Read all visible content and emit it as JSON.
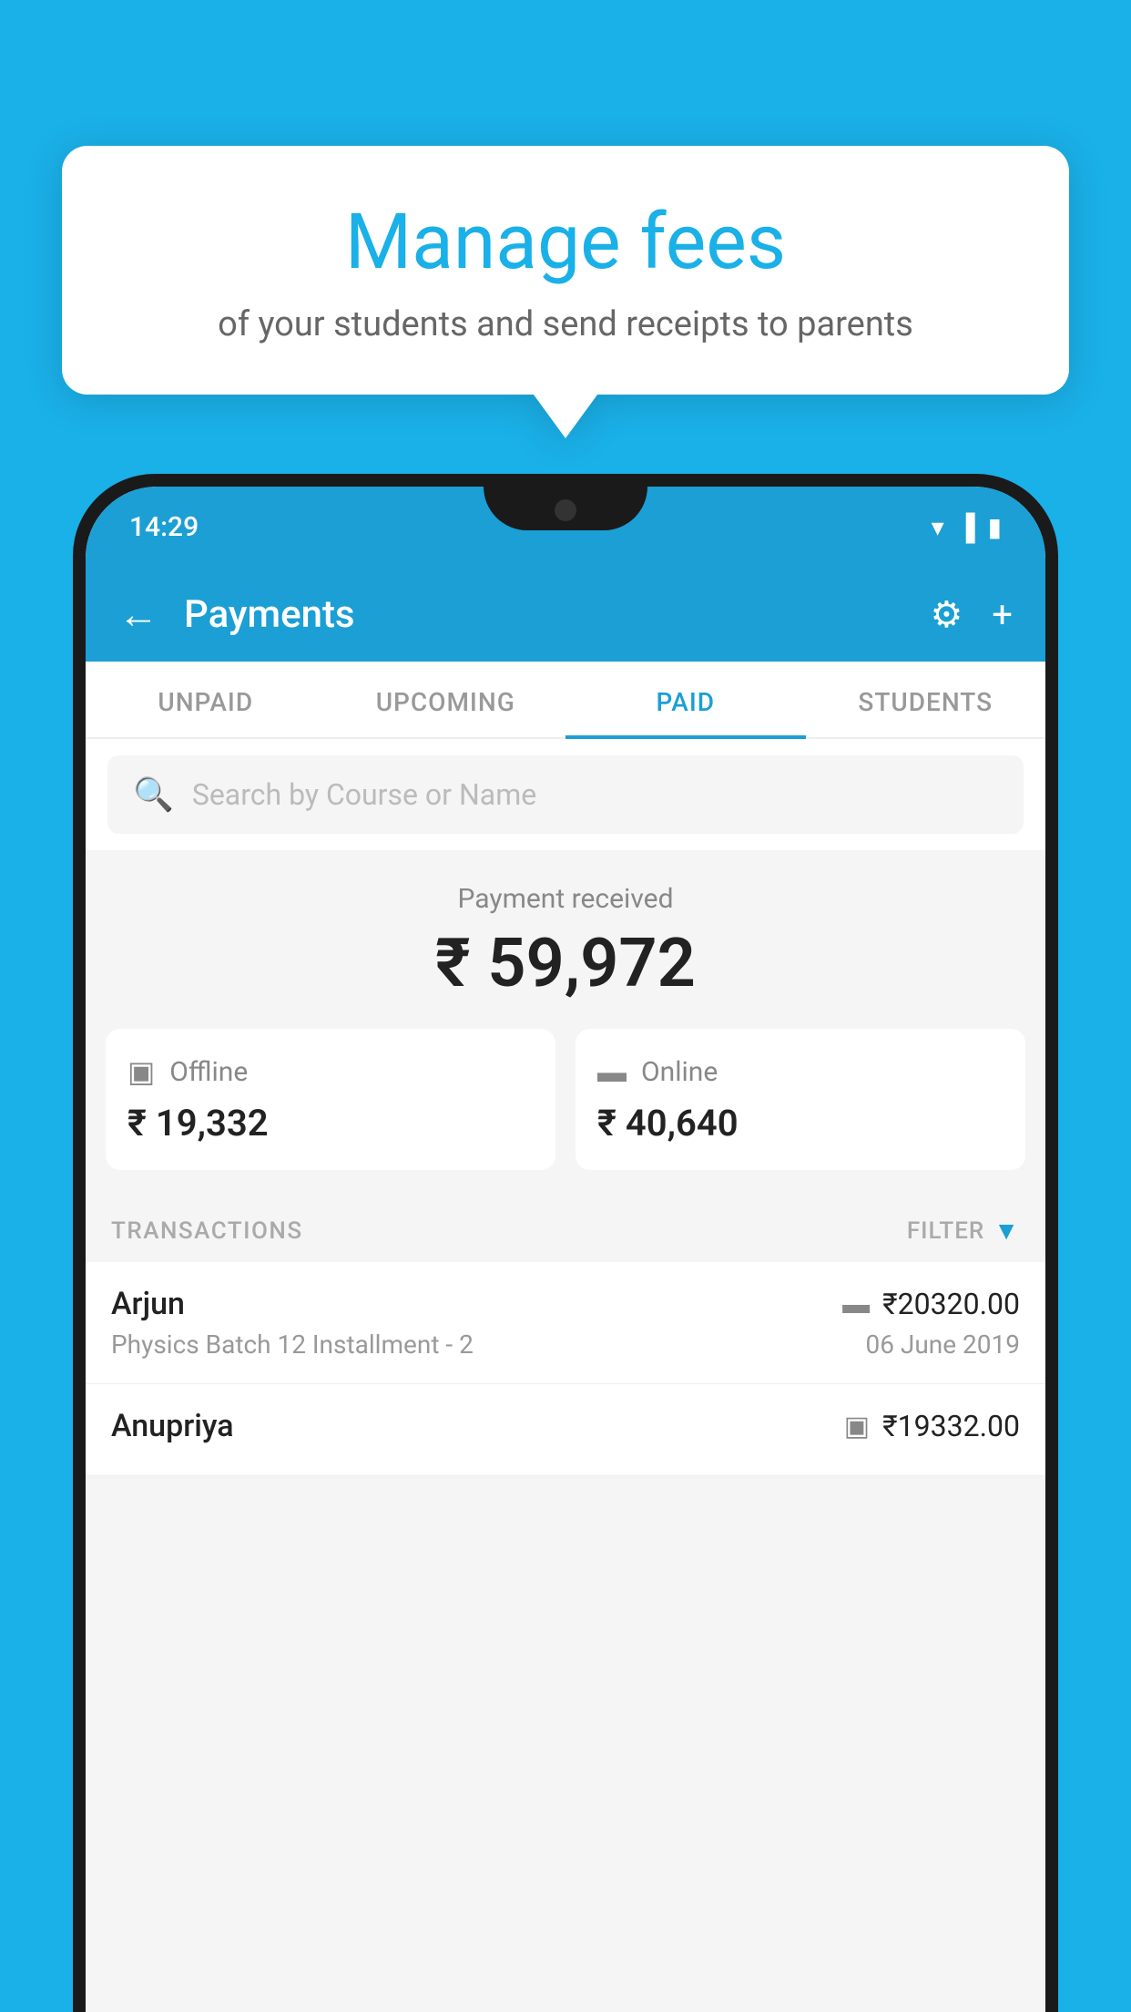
{
  "background_color": "#1ab0e8",
  "bubble": {
    "title": "Manage fees",
    "subtitle": "of your students and send receipts to parents"
  },
  "status_bar": {
    "time": "14:29",
    "icons": [
      "wifi",
      "signal",
      "battery"
    ]
  },
  "header": {
    "back_label": "←",
    "title": "Payments",
    "settings_icon": "⚙",
    "add_icon": "+"
  },
  "tabs": [
    {
      "label": "UNPAID",
      "active": false
    },
    {
      "label": "UPCOMING",
      "active": false
    },
    {
      "label": "PAID",
      "active": true
    },
    {
      "label": "STUDENTS",
      "active": false
    }
  ],
  "search": {
    "placeholder": "Search by Course or Name"
  },
  "payment_received": {
    "label": "Payment received",
    "amount": "₹ 59,972"
  },
  "payment_cards": [
    {
      "type": "Offline",
      "amount": "₹ 19,332",
      "icon": "💳"
    },
    {
      "type": "Online",
      "amount": "₹ 40,640",
      "icon": "💳"
    }
  ],
  "transactions_section": {
    "label": "TRANSACTIONS",
    "filter_label": "FILTER"
  },
  "transactions": [
    {
      "name": "Arjun",
      "amount": "₹20320.00",
      "course": "Physics Batch 12 Installment - 2",
      "date": "06 June 2019",
      "icon": "card"
    },
    {
      "name": "Anupriya",
      "amount": "₹19332.00",
      "course": "",
      "date": "",
      "icon": "cash"
    }
  ]
}
